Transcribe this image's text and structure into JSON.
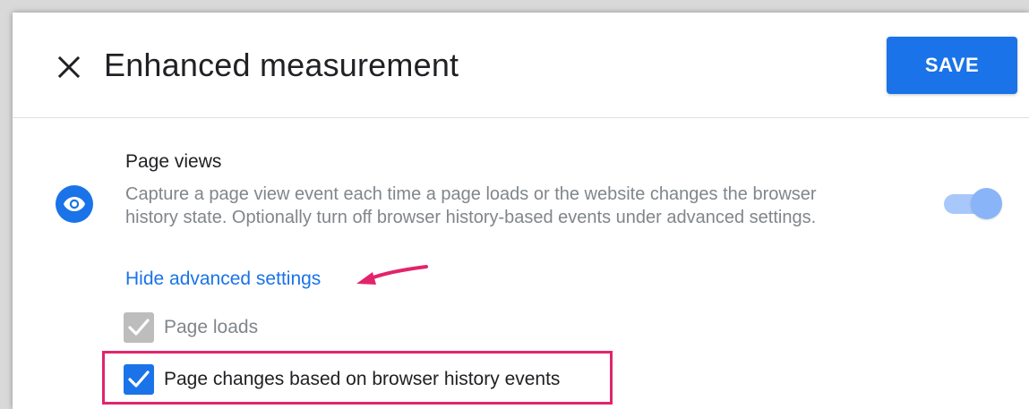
{
  "header": {
    "title": "Enhanced measurement",
    "save_label": "SAVE",
    "close_icon": "close-icon"
  },
  "section": {
    "icon": "eye-icon",
    "title": "Page views",
    "description": "Capture a page view event each time a page loads or the website changes the browser history state. Optionally turn off browser history-based events under advanced settings.",
    "toggle_on": true,
    "advanced_link": "Hide advanced settings"
  },
  "options": [
    {
      "label": "Page loads",
      "checked": true,
      "disabled": true
    },
    {
      "label": "Page changes based on browser history events",
      "checked": true,
      "disabled": false
    }
  ],
  "annotation": {
    "arrow_color": "#e2246b",
    "box_color": "#e2246b"
  },
  "colors": {
    "accent": "#1a73e8",
    "toggle_track": "#a8c7fa",
    "toggle_knob": "#8ab4f8",
    "muted_text": "#80868b",
    "text": "#202124"
  }
}
